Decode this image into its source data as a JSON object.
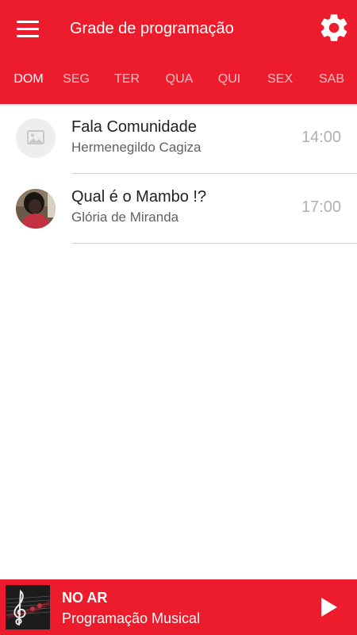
{
  "header": {
    "title": "Grade de programação",
    "menu_icon": "menu-icon",
    "settings_icon": "gear-icon"
  },
  "tabs": [
    {
      "label": "DOM",
      "active": true
    },
    {
      "label": "SEG",
      "active": false
    },
    {
      "label": "TER",
      "active": false
    },
    {
      "label": "QUA",
      "active": false
    },
    {
      "label": "QUI",
      "active": false
    },
    {
      "label": "SEX",
      "active": false
    },
    {
      "label": "SAB",
      "active": false
    }
  ],
  "schedule": [
    {
      "title": "Fala Comunidade",
      "host": "Hermenegildo Cagiza",
      "time": "14:00",
      "avatar": "image-placeholder-icon"
    },
    {
      "title": "Qual é o Mambo !?",
      "host": "Glória de Miranda",
      "time": "17:00",
      "avatar": "host-photo"
    }
  ],
  "player": {
    "status_label": "NO AR",
    "now_playing": "Programação Musical",
    "play_icon": "play-icon",
    "cover_icon": "treble-clef-icon"
  },
  "colors": {
    "accent": "#ec1c2c",
    "text_primary": "#212121",
    "text_secondary": "#616161",
    "time": "#b0b0b0",
    "divider": "#d6d6d6"
  }
}
